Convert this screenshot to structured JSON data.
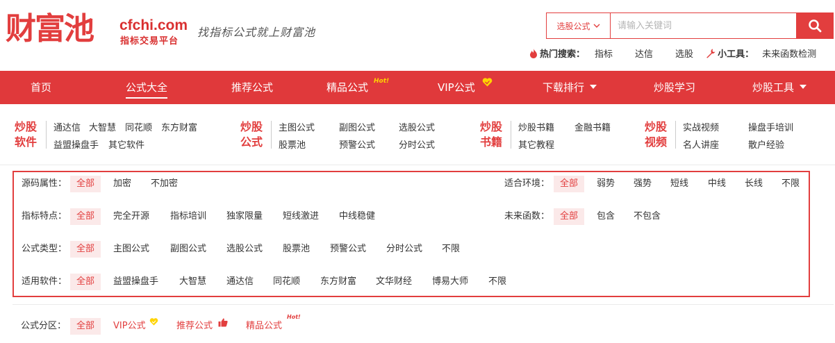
{
  "brand": {
    "logo_text": "财富池",
    "domain": "cfchi.com",
    "tagline": "指标交易平台",
    "slogan": "找指标公式就上财富池",
    "accent_color": "#e0393b"
  },
  "search": {
    "select_value": "选股公式",
    "placeholder": "请输入关键词",
    "button_icon": "search-icon"
  },
  "hot": {
    "label": "热门搜索：",
    "keywords": [
      "指标",
      "达信",
      "选股"
    ],
    "tools_label": "小工具：",
    "tools": [
      "未来函数检测"
    ]
  },
  "nav": [
    {
      "label": "首页",
      "active": true
    },
    {
      "label": "公式大全",
      "active": true
    },
    {
      "label": "推荐公式"
    },
    {
      "label": "精品公式",
      "badge": "Hot!"
    },
    {
      "label": "VIP公式",
      "icon": "heart-icon"
    },
    {
      "label": "下载排行",
      "dropdown": true
    },
    {
      "label": "炒股学习"
    },
    {
      "label": "炒股工具",
      "dropdown": true
    }
  ],
  "categories": [
    {
      "title1": "炒股",
      "title2": "软件",
      "links": [
        "通达信",
        "大智慧",
        "同花顺",
        "东方财富",
        "益盟操盘手",
        "其它软件"
      ]
    },
    {
      "title1": "炒股",
      "title2": "公式",
      "links": [
        "主图公式",
        "副图公式",
        "选股公式",
        "股票池",
        "预警公式",
        "分时公式"
      ]
    },
    {
      "title1": "炒股",
      "title2": "书籍",
      "links": [
        "炒股书籍",
        "金融书籍",
        "其它教程"
      ]
    },
    {
      "title1": "炒股",
      "title2": "视频",
      "links": [
        "实战视频",
        "操盘手培训",
        "名人讲座",
        "散户经验"
      ]
    }
  ],
  "filters": {
    "source": {
      "label": "源码属性：",
      "options": [
        "全部",
        "加密",
        "不加密"
      ]
    },
    "env": {
      "label": "适合环境：",
      "options": [
        "全部",
        "弱势",
        "强势",
        "短线",
        "中线",
        "长线",
        "不限"
      ]
    },
    "feature": {
      "label": "指标特点：",
      "options": [
        "全部",
        "完全开源",
        "指标培训",
        "独家限量",
        "短线激进",
        "中线稳健"
      ]
    },
    "future": {
      "label": "未来函数：",
      "options": [
        "全部",
        "包含",
        "不包含"
      ]
    },
    "type": {
      "label": "公式类型：",
      "options": [
        "全部",
        "主图公式",
        "副图公式",
        "选股公式",
        "股票池",
        "预警公式",
        "分时公式",
        "不限"
      ]
    },
    "software": {
      "label": "适用软件：",
      "options": [
        "全部",
        "益盟操盘手",
        "大智慧",
        "通达信",
        "同花顺",
        "东方财富",
        "文华财经",
        "博易大师",
        "不限"
      ]
    }
  },
  "zone": {
    "label": "公式分区：",
    "options": [
      "全部",
      "VIP公式",
      "推荐公式",
      "精品公式"
    ],
    "badge_hot": "Hot!"
  }
}
